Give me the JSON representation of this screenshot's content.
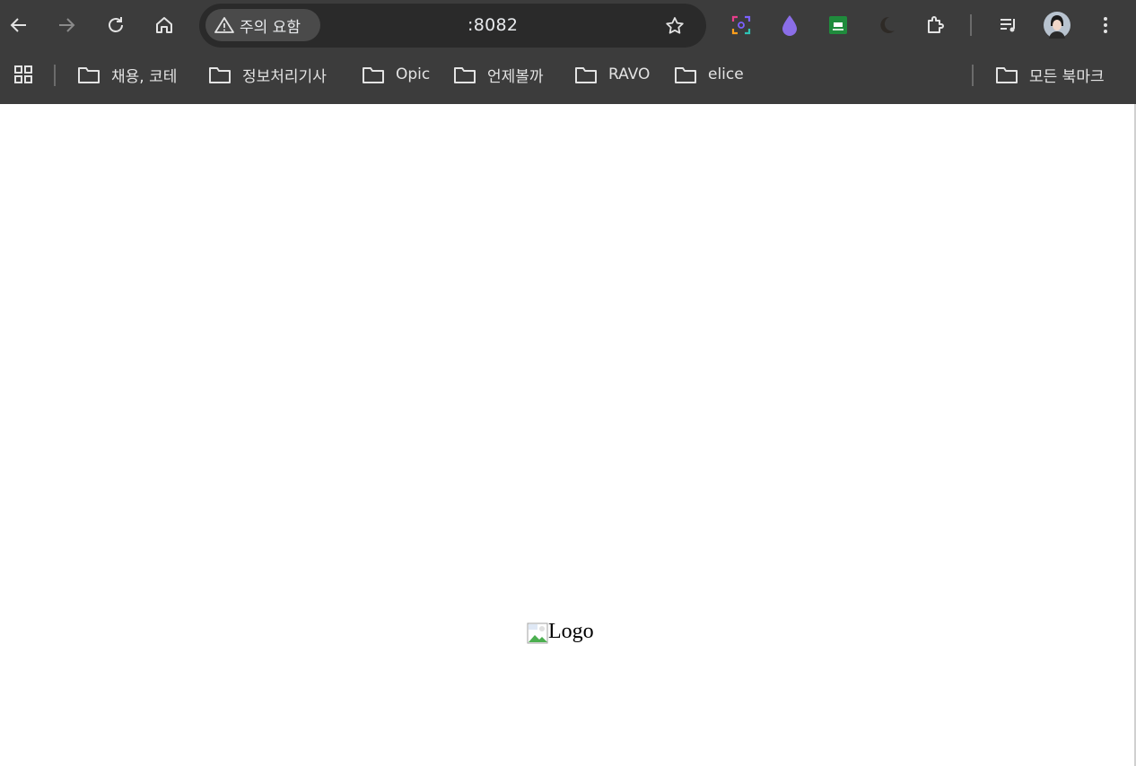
{
  "toolbar": {
    "security_label": "주의 요함",
    "url": ":8082",
    "icons": [
      "back-icon",
      "forward-icon",
      "reload-icon",
      "home-icon",
      "warning-icon",
      "star-icon"
    ]
  },
  "extensions": [
    "screen-capture-icon",
    "purple-drop-icon",
    "green-extension-icon",
    "moon-icon",
    "puzzle-icon",
    "media-queue-icon",
    "profile-avatar",
    "menu-icon"
  ],
  "bookmarks": {
    "items": [
      {
        "label": "채용, 코테"
      },
      {
        "label": "정보처리기사"
      },
      {
        "label": "Opic"
      },
      {
        "label": "언제볼까"
      },
      {
        "label": "RAVO"
      },
      {
        "label": "elice"
      }
    ],
    "all_bookmarks": "모든 북마크"
  },
  "page": {
    "logo_alt": "Logo"
  },
  "colors": {
    "chrome_bg": "#3c3c3c",
    "omnibox_bg": "#2a2a2a",
    "chip_bg": "#4a4a4a",
    "text_light": "#e3e3e3",
    "page_bg": "#ffffff"
  }
}
